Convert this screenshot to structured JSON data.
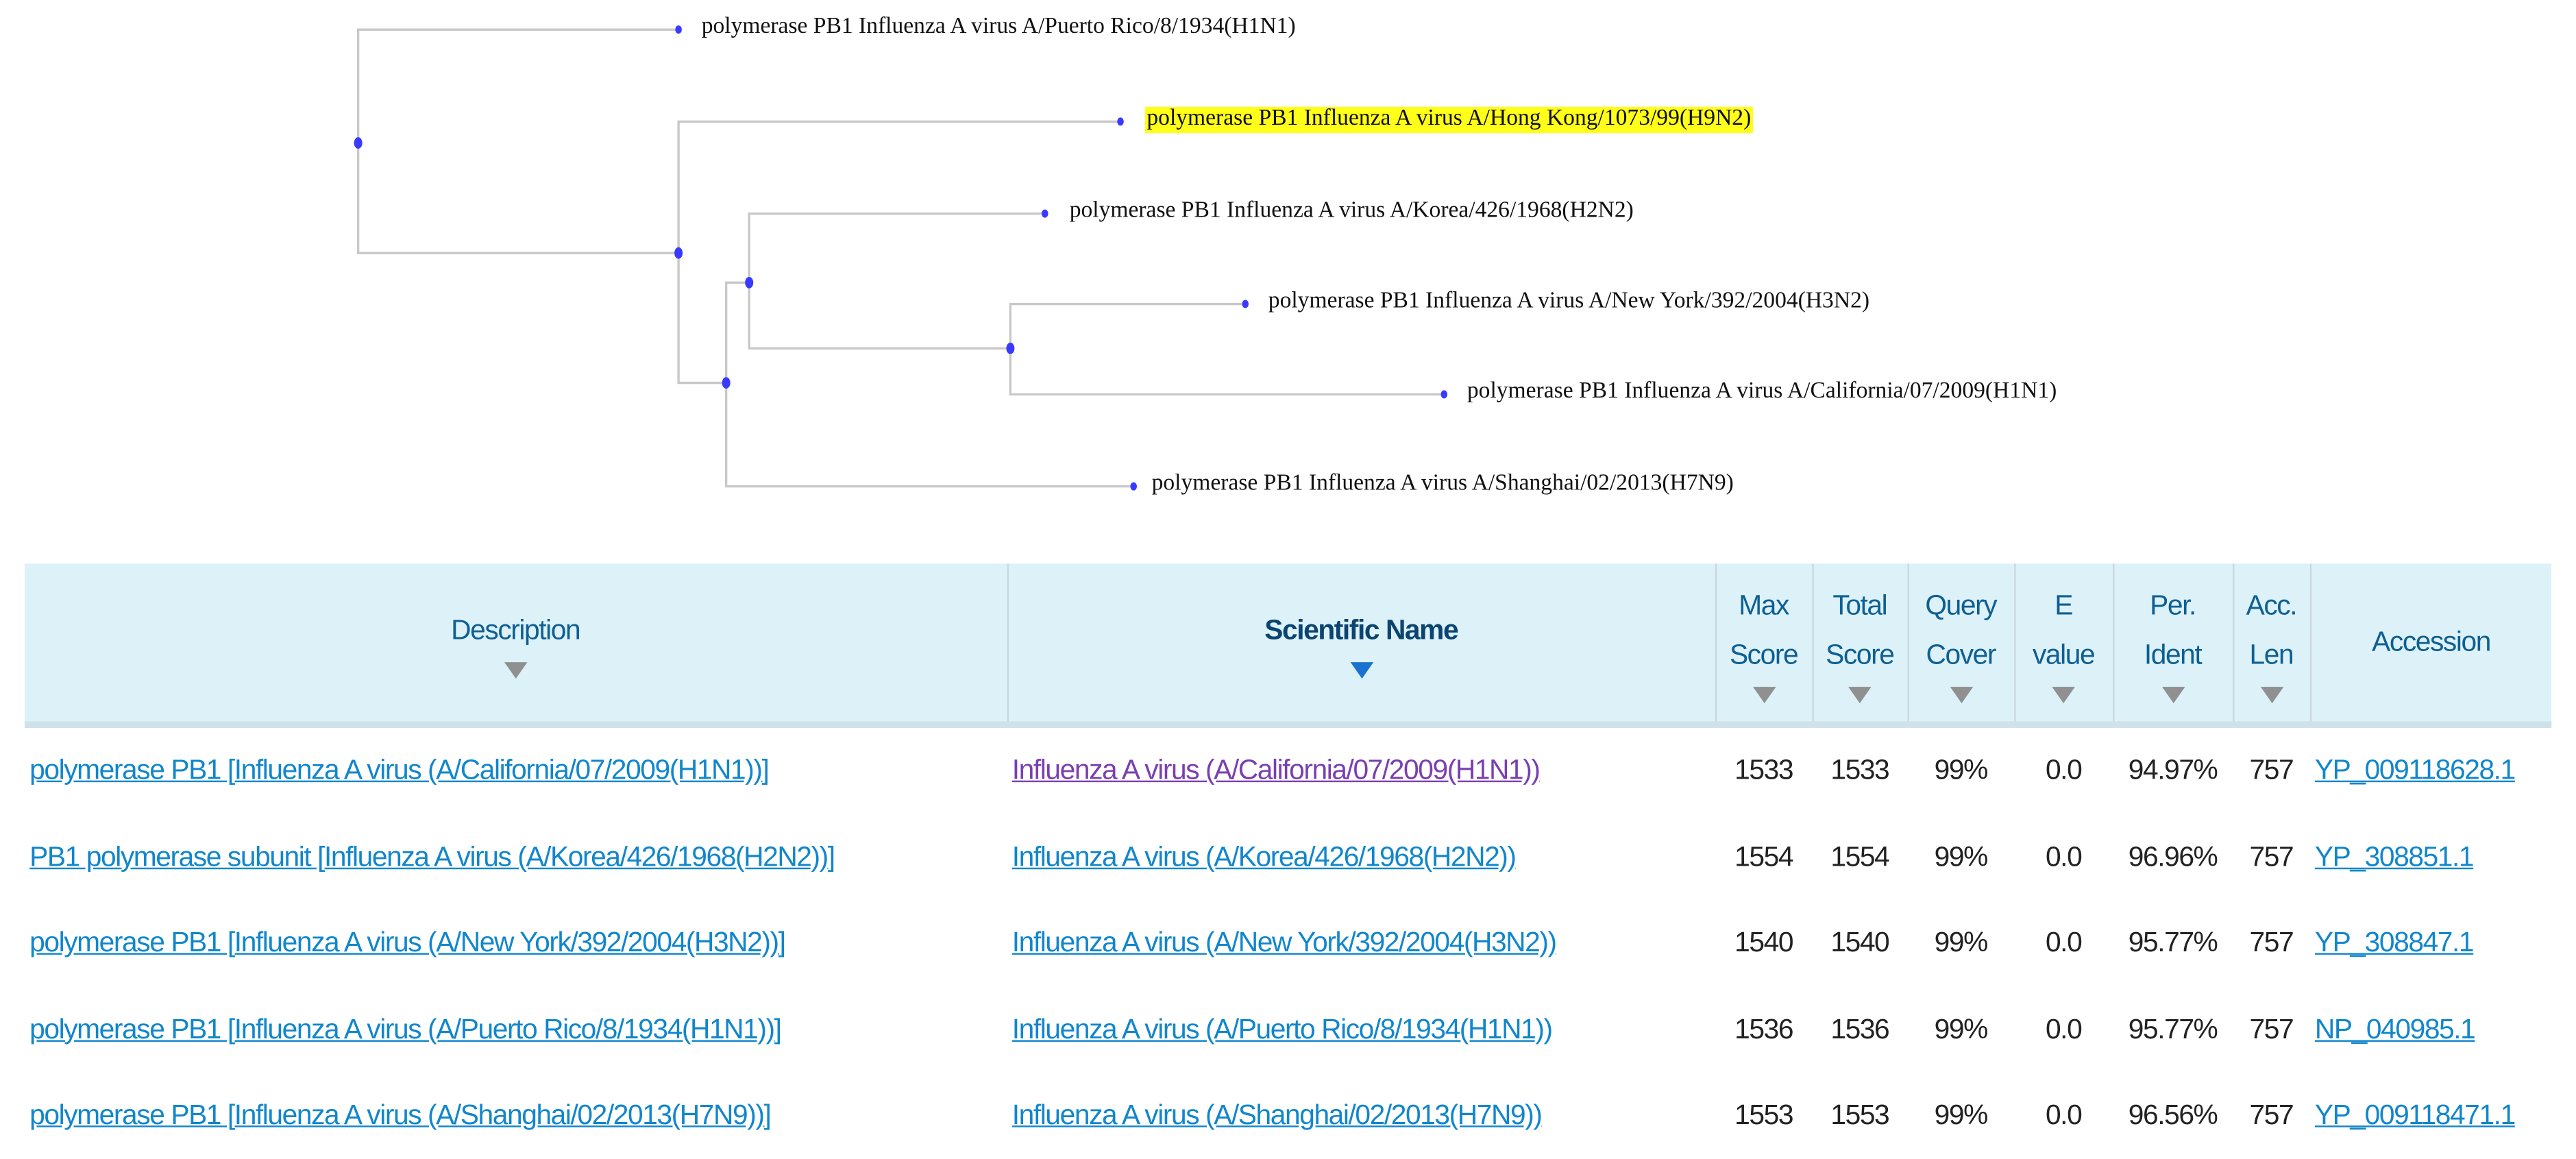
{
  "tree": {
    "leaves": [
      {
        "label": "polymerase PB1 Influenza A virus A/Puerto Rico/8/1934(H1N1)",
        "highlighted": false
      },
      {
        "label": "polymerase PB1 Influenza A virus  A/Hong Kong/1073/99(H9N2)",
        "highlighted": true
      },
      {
        "label": "polymerase PB1 Influenza A virus A/Korea/426/1968(H2N2)",
        "highlighted": false
      },
      {
        "label": "polymerase PB1 Influenza A virus A/New York/392/2004(H3N2)",
        "highlighted": false
      },
      {
        "label": "polymerase PB1 Influenza A virus A/California/07/2009(H1N1)",
        "highlighted": false
      },
      {
        "label": "polymerase PB1 Influenza A virus A/Shanghai/02/2013(H7N9)",
        "highlighted": false
      }
    ],
    "highlight_color": "#ffff1a",
    "node_color": "#3a3aff"
  },
  "table": {
    "headers": [
      {
        "line1": "Description",
        "line2": ""
      },
      {
        "line1": "Scientific Name",
        "line2": ""
      },
      {
        "line1": "Max",
        "line2": "Score"
      },
      {
        "line1": "Total",
        "line2": "Score"
      },
      {
        "line1": "Query",
        "line2": "Cover"
      },
      {
        "line1": "E",
        "line2": "value"
      },
      {
        "line1": "Per.",
        "line2": "Ident"
      },
      {
        "line1": "Acc.",
        "line2": "Len"
      },
      {
        "line1": "Accession",
        "line2": ""
      }
    ],
    "rows": [
      {
        "description": "polymerase PB1 [Influenza A virus (A/California/07/2009(H1N1))]",
        "scientific_name": "Influenza A virus (A/California/07/2009(H1N1))",
        "max_score": "1533",
        "total_score": "1533",
        "query_cover": "99%",
        "e_value": "0.0",
        "per_ident": "94.97%",
        "acc_len": "757",
        "accession": "YP_009118628.1"
      },
      {
        "description": "PB1 polymerase subunit [Influenza A virus (A/Korea/426/1968(H2N2))]",
        "scientific_name": "Influenza A virus (A/Korea/426/1968(H2N2))",
        "max_score": "1554",
        "total_score": "1554",
        "query_cover": "99%",
        "e_value": "0.0",
        "per_ident": "96.96%",
        "acc_len": "757",
        "accession": "YP_308851.1"
      },
      {
        "description": "polymerase PB1 [Influenza A virus (A/New York/392/2004(H3N2))]",
        "scientific_name": "Influenza A virus (A/New York/392/2004(H3N2))",
        "max_score": "1540",
        "total_score": "1540",
        "query_cover": "99%",
        "e_value": "0.0",
        "per_ident": "95.77%",
        "acc_len": "757",
        "accession": "YP_308847.1"
      },
      {
        "description": "polymerase PB1 [Influenza A virus (A/Puerto Rico/8/1934(H1N1))]",
        "scientific_name": "Influenza A virus (A/Puerto Rico/8/1934(H1N1))",
        "max_score": "1536",
        "total_score": "1536",
        "query_cover": "99%",
        "e_value": "0.0",
        "per_ident": "95.77%",
        "acc_len": "757",
        "accession": "NP_040985.1"
      },
      {
        "description": "polymerase PB1 [Influenza A virus (A/Shanghai/02/2013(H7N9))]",
        "scientific_name": "Influenza A virus (A/Shanghai/02/2013(H7N9))",
        "max_score": "1553",
        "total_score": "1553",
        "query_cover": "99%",
        "e_value": "0.0",
        "per_ident": "96.56%",
        "acc_len": "757",
        "accession": "YP_009118471.1"
      }
    ]
  }
}
